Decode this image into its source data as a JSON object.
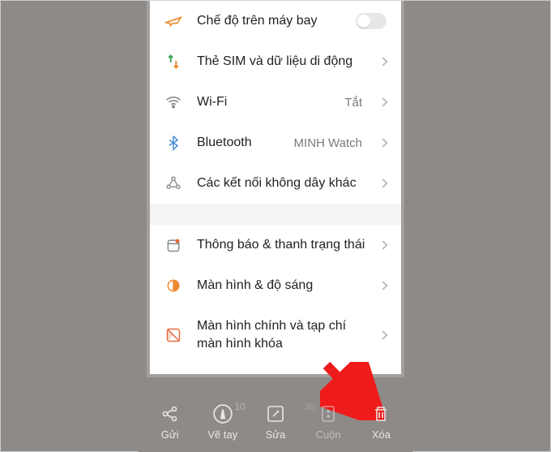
{
  "settings": {
    "group1": [
      {
        "id": "airplane",
        "label": "Chế độ trên máy bay",
        "kind": "toggle",
        "icon": "airplane"
      },
      {
        "id": "sim",
        "label": "Thẻ SIM và dữ liệu di động",
        "kind": "link",
        "icon": "sim"
      },
      {
        "id": "wifi",
        "label": "Wi-Fi",
        "kind": "link",
        "icon": "wifi",
        "value": "Tắt"
      },
      {
        "id": "bluetooth",
        "label": "Bluetooth",
        "kind": "link",
        "icon": "bluetooth",
        "value": "MINH Watch"
      },
      {
        "id": "wireless",
        "label": "Các kết nối không dây khác",
        "kind": "link",
        "icon": "wireless"
      }
    ],
    "group2": [
      {
        "id": "notif",
        "label": "Thông báo & thanh trạng thái",
        "kind": "link",
        "icon": "notif"
      },
      {
        "id": "display",
        "label": "Màn hình & độ sáng",
        "kind": "link",
        "icon": "display"
      },
      {
        "id": "home",
        "label": "Màn hình chính và tạp chí màn hình khóa",
        "kind": "link",
        "icon": "home"
      }
    ]
  },
  "toolbar": {
    "share": {
      "label": "Gửi"
    },
    "draw": {
      "label": "Vẽ tay",
      "hint": "10"
    },
    "edit": {
      "label": "Sửa"
    },
    "scroll": {
      "label": "Cuộn",
      "hint": "30"
    },
    "delete": {
      "label": "Xóa"
    }
  }
}
